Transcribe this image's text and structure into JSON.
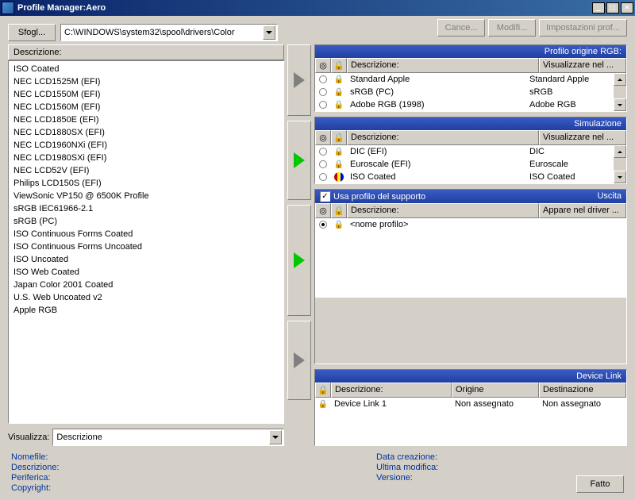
{
  "window": {
    "title": "Profile Manager:Aero"
  },
  "toolbar": {
    "browse": "Sfogl...",
    "path": "C:\\WINDOWS\\system32\\spool\\drivers\\Color",
    "buttons": {
      "cancel": "Cance...",
      "modify": "Modifi...",
      "settings": "Impostazioni prof..."
    }
  },
  "left": {
    "header": "Descrizione:",
    "items": [
      "ISO Coated",
      "NEC LCD1525M (EFI)",
      "NEC LCD1550M (EFI)",
      "NEC LCD1560M (EFI)",
      "NEC LCD1850E (EFI)",
      "NEC LCD1880SX (EFI)",
      "NEC LCD1960NXi (EFI)",
      "NEC LCD1980SXi (EFI)",
      "NEC LCD52V (EFI)",
      "Philips LCD150S (EFI)",
      "ViewSonic VP150 @ 6500K Profile",
      "sRGB IEC61966-2.1",
      "sRGB (PC)",
      "ISO Continuous Forms Coated",
      "ISO Continuous Forms Uncoated",
      "ISO Uncoated",
      "ISO Web Coated",
      "Japan Color 2001 Coated",
      "U.S. Web Uncoated v2",
      "Apple RGB"
    ],
    "viz_label": "Visualizza:",
    "viz_value": "Descrizione"
  },
  "rgb": {
    "title": "Profilo origine RGB:",
    "cols": {
      "desc": "Descrizione:",
      "display": "Visualizzare nel ..."
    },
    "rows": [
      {
        "desc": "Standard Apple",
        "display": "Standard Apple"
      },
      {
        "desc": "sRGB (PC)",
        "display": "sRGB"
      },
      {
        "desc": "Adobe RGB (1998)",
        "display": "Adobe RGB"
      }
    ]
  },
  "sim": {
    "title": "Simulazione",
    "cols": {
      "desc": "Descrizione:",
      "display": "Visualizzare nel ..."
    },
    "rows": [
      {
        "desc": "DIC (EFI)",
        "display": "DIC"
      },
      {
        "desc": "Euroscale (EFI)",
        "display": "Euroscale"
      },
      {
        "desc": "ISO Coated",
        "display": "ISO Coated",
        "iso": true
      }
    ]
  },
  "uscita": {
    "title": "Uscita",
    "chk_label": "Usa profilo del supporto",
    "cols": {
      "desc": "Descrizione:",
      "driver": "Appare nel driver ..."
    },
    "rows": [
      {
        "desc": "<nome profilo>",
        "selected": true
      }
    ]
  },
  "devicelink": {
    "title": "Device Link",
    "cols": {
      "desc": "Descrizione:",
      "origin": "Origine",
      "dest": "Destinazione"
    },
    "rows": [
      {
        "desc": "Device Link 1",
        "origin": "Non assegnato",
        "dest": "Non assegnato"
      }
    ]
  },
  "footer": {
    "left": {
      "filename": "Nomefile:",
      "desc": "Descrizione:",
      "device": "Periferica:",
      "copyright": "Copyright:"
    },
    "right": {
      "created": "Data creazione:",
      "modified": "Ultima modifica:",
      "version": "Versione:"
    },
    "done": "Fatto"
  }
}
